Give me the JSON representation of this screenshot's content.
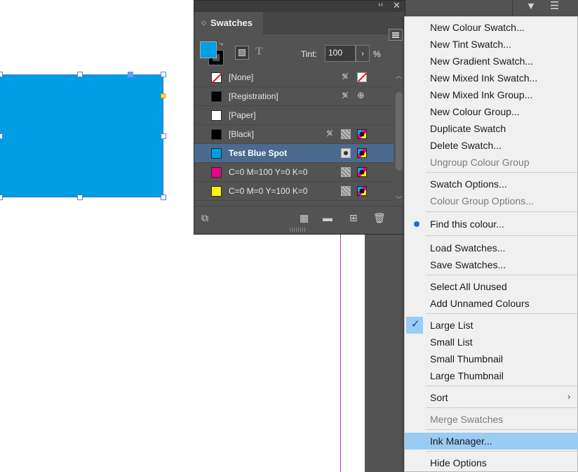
{
  "panel": {
    "tab_label": "Swatches",
    "tint_label": "Tint:",
    "tint_value": "100",
    "tint_unit": "%",
    "fill_color": "#009ee3",
    "swatches": [
      {
        "name": "[None]",
        "chip_color": "none",
        "icons": [
          "pencil-crossed",
          "none"
        ]
      },
      {
        "name": "[Registration]",
        "chip_color": "#000000",
        "icons": [
          "pencil-crossed",
          "registration"
        ]
      },
      {
        "name": "[Paper]",
        "chip_color": "#ffffff",
        "icons": []
      },
      {
        "name": "[Black]",
        "chip_color": "#000000",
        "icons": [
          "pencil-crossed",
          "grid",
          "process"
        ]
      },
      {
        "name": "Test Blue Spot",
        "chip_color": "#009ee3",
        "icons": [
          "spot",
          "process"
        ],
        "selected": true
      },
      {
        "name": "C=0 M=100 Y=0 K=0",
        "chip_color": "#ec008c",
        "icons": [
          "grid",
          "process"
        ]
      },
      {
        "name": "C=0 M=0 Y=100 K=0",
        "chip_color": "#fff200",
        "icons": [
          "grid",
          "process"
        ]
      }
    ]
  },
  "menu": {
    "items": [
      {
        "label": "New Colour Swatch...",
        "state": "enabled"
      },
      {
        "label": "New Tint Swatch...",
        "state": "enabled"
      },
      {
        "label": "New Gradient Swatch...",
        "state": "enabled"
      },
      {
        "label": "New Mixed Ink Swatch...",
        "state": "enabled"
      },
      {
        "label": "New Mixed Ink Group...",
        "state": "enabled"
      },
      {
        "label": "New Colour Group...",
        "state": "enabled"
      },
      {
        "label": "Duplicate Swatch",
        "state": "enabled"
      },
      {
        "label": "Delete Swatch...",
        "state": "enabled"
      },
      {
        "label": "Ungroup Colour Group",
        "state": "disabled"
      },
      {
        "label": "Swatch Options...",
        "state": "enabled"
      },
      {
        "label": "Colour Group Options...",
        "state": "disabled"
      },
      {
        "label": "Find this colour...",
        "state": "enabled",
        "mark": "bullet"
      },
      {
        "label": "Load Swatches...",
        "state": "enabled"
      },
      {
        "label": "Save Swatches...",
        "state": "enabled"
      },
      {
        "label": "Select All Unused",
        "state": "enabled"
      },
      {
        "label": "Add Unnamed Colours",
        "state": "enabled"
      },
      {
        "label": "Large List",
        "state": "enabled",
        "mark": "check"
      },
      {
        "label": "Small List",
        "state": "enabled"
      },
      {
        "label": "Small Thumbnail",
        "state": "enabled"
      },
      {
        "label": "Large Thumbnail",
        "state": "enabled"
      },
      {
        "label": "Sort",
        "state": "enabled",
        "submenu": true
      },
      {
        "label": "Merge Swatches",
        "state": "disabled"
      },
      {
        "label": "Ink Manager...",
        "state": "enabled",
        "highlighted": true
      },
      {
        "label": "Hide Options",
        "state": "enabled"
      }
    ]
  },
  "colors": {
    "shape_fill": "#009ee3",
    "menu_highlight": "#99ccf5",
    "selected_row": "#4a6a8f"
  }
}
